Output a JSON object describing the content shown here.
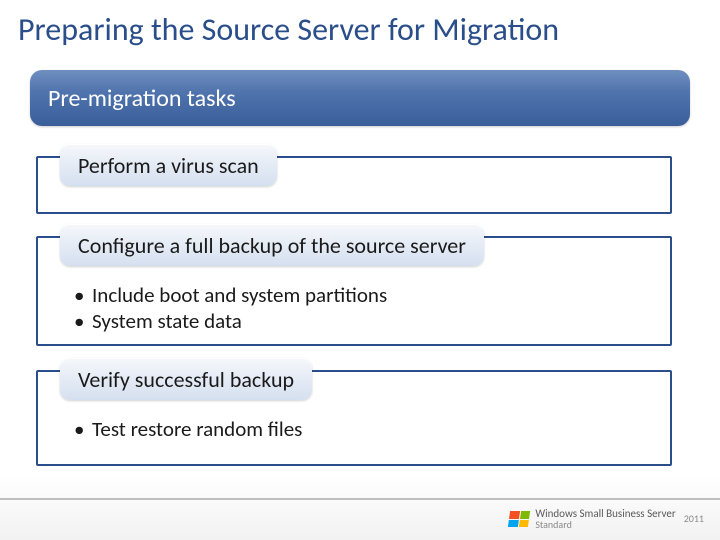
{
  "title": "Preparing the Source Server for Migration",
  "header": {
    "label": "Pre-migration tasks"
  },
  "sections": [
    {
      "label": "Perform a virus scan",
      "bullets": []
    },
    {
      "label": "Configure a full backup of the source server",
      "bullets": [
        "Include boot and system partitions",
        "System state data"
      ]
    },
    {
      "label": "Verify successful backup",
      "bullets": [
        "Test restore random files"
      ]
    }
  ],
  "footer": {
    "brand_line1": "Windows Small Business Server",
    "brand_line2": "Standard",
    "year": "2011"
  }
}
